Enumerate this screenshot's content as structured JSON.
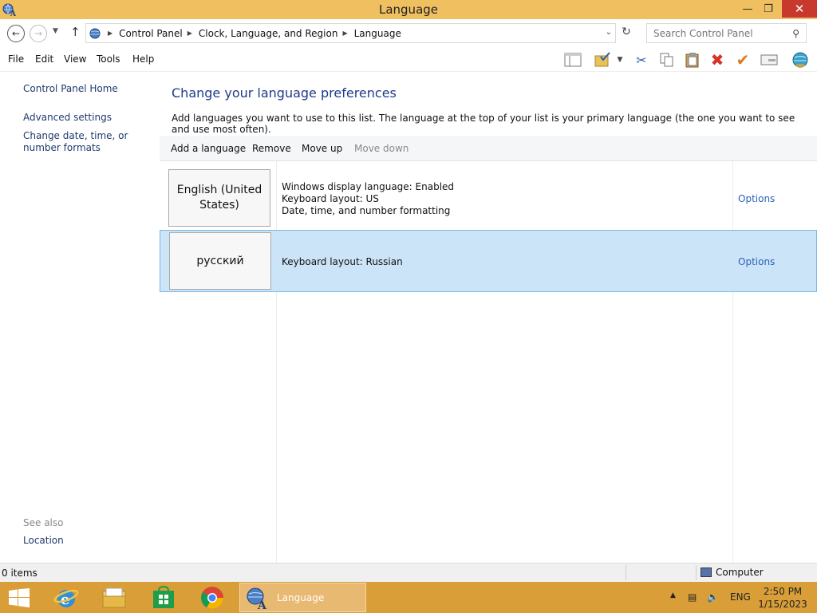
{
  "window": {
    "title": "Language"
  },
  "address": {
    "breadcrumbs": [
      "Control Panel",
      "Clock, Language, and Region",
      "Language"
    ],
    "search_placeholder": "Search Control Panel"
  },
  "menu": [
    "File",
    "Edit",
    "View",
    "Tools",
    "Help"
  ],
  "toolbar_icons": [
    "layout-pane-icon",
    "folder-check-icon",
    "cut-icon",
    "copy-icon",
    "paste-icon",
    "delete-icon",
    "properties-check-icon",
    "panel-icon",
    "globe-icon"
  ],
  "sidebar": {
    "links": [
      "Control Panel Home",
      "Advanced settings",
      "Change date, time, or number formats"
    ],
    "see_also_label": "See also",
    "see_also_links": [
      "Location"
    ]
  },
  "main": {
    "heading": "Change your language preferences",
    "description": "Add languages you want to use to this list. The language at the top of your list is your primary language (the one you want to see and use most often).",
    "commands": {
      "add": "Add a language",
      "remove": "Remove",
      "move_up": "Move up",
      "move_down": "Move down"
    },
    "languages": [
      {
        "name": "English (United States)",
        "details": [
          "Windows display language: Enabled",
          "Keyboard layout: US",
          "Date, time, and number formatting"
        ],
        "options": "Options",
        "selected": false
      },
      {
        "name": "русский",
        "details": [
          "Keyboard layout: Russian"
        ],
        "options": "Options",
        "selected": true
      }
    ]
  },
  "status": {
    "items": "0 items",
    "location": "Computer"
  },
  "taskbar": {
    "active_window": "Language",
    "input_language": "ENG",
    "time": "2:50 PM",
    "date": "1/15/2023"
  },
  "colors": {
    "titlebar": "#f0c060",
    "taskbar": "#d99e38",
    "selection": "#cce4f7",
    "link": "#1e3a8a",
    "close": "#c7382d"
  }
}
